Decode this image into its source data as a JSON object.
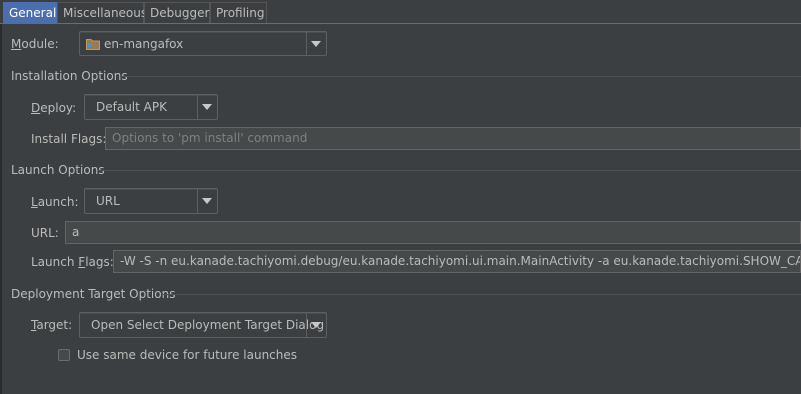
{
  "tabs": [
    {
      "label": "General",
      "active": true
    },
    {
      "label": "Miscellaneous",
      "active": false
    },
    {
      "label": "Debugger",
      "active": false
    },
    {
      "label": "Profiling",
      "active": false
    }
  ],
  "module": {
    "label_mnemonic": "M",
    "label_rest": "odule:",
    "value": "en-mangafox",
    "icon": "module-folder-icon"
  },
  "installation": {
    "title": "Installation Options",
    "deploy_mnemonic": "D",
    "deploy_rest": "eploy:",
    "deploy_value": "Default APK",
    "install_flags_label": "Install Flags:",
    "install_flags_placeholder": "Options to 'pm install' command",
    "install_flags_value": ""
  },
  "launch": {
    "title": "Launch Options",
    "launch_mnemonic": "L",
    "launch_rest": "aunch:",
    "launch_value": "URL",
    "url_label": "URL:",
    "url_value": "a",
    "flags_label_pre": "Launch ",
    "flags_mnemonic": "F",
    "flags_label_post": "lags:",
    "flags_value": "-W -S -n eu.kanade.tachiyomi.debug/eu.kanade.tachiyomi.ui.main.MainActivity -a eu.kanade.tachiyomi.SHOW_CATALOGUES"
  },
  "deployment_target": {
    "title": "Deployment Target Options",
    "target_mnemonic": "T",
    "target_rest": "arget:",
    "target_value": "Open Select Deployment Target Dialog",
    "same_device_label": "Use same device for future launches",
    "same_device_checked": false
  },
  "colors": {
    "background": "#3c3f41",
    "accent": "#4b6eaf",
    "text": "#bbbbbb"
  }
}
